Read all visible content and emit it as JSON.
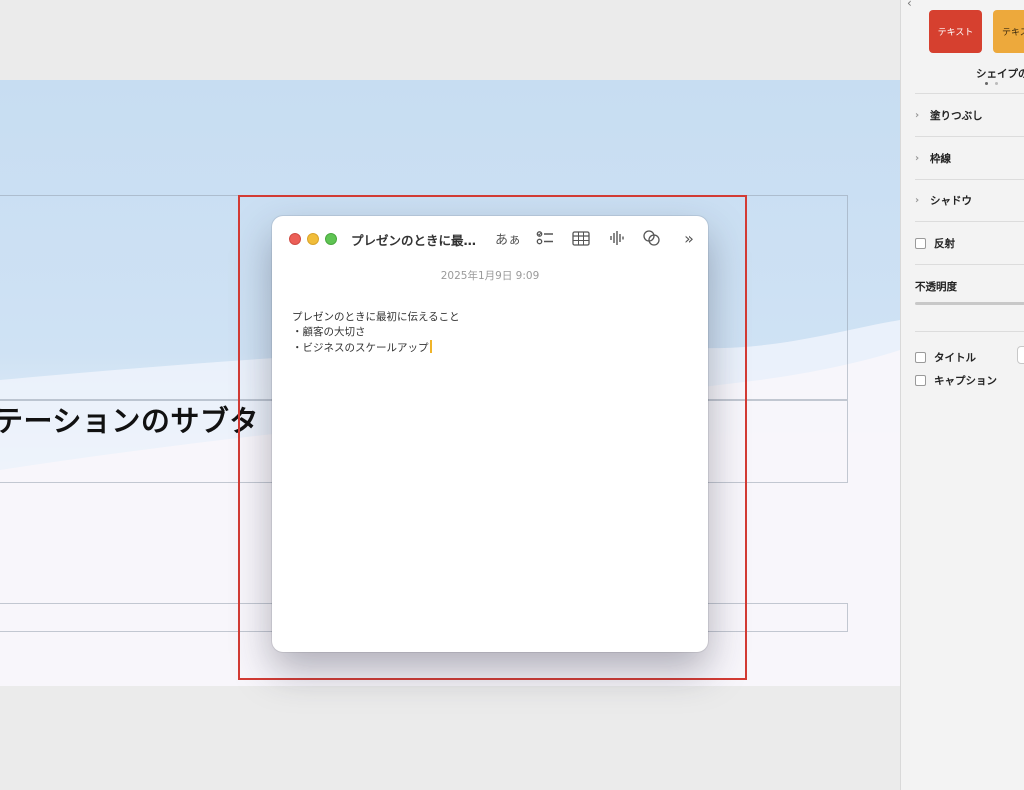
{
  "slide": {
    "subtitle": "テーションのサブタ"
  },
  "note": {
    "title": "プレゼンのときに最…",
    "date": "2025年1月9日 9:09",
    "lines": [
      "プレゼンのときに最初に伝えること",
      "・顧客の大切さ",
      "・ビジネスのスケールアップ"
    ],
    "toolbar": {
      "format_label": "あぁ",
      "more_label": "»"
    }
  },
  "sidebar": {
    "styles": [
      "テキスト",
      "テキス"
    ],
    "shape_style_label": "シェイプの",
    "sections": {
      "fill": "塗りつぶし",
      "border": "枠線",
      "shadow": "シャドウ",
      "reflection": "反射",
      "opacity": "不透明度"
    },
    "checkboxes": {
      "title": "タイトル",
      "caption": "キャプション"
    }
  },
  "colors": {
    "highlight": "#d33b34",
    "accent_red": "#d6402f",
    "accent_orange": "#eda93c"
  }
}
